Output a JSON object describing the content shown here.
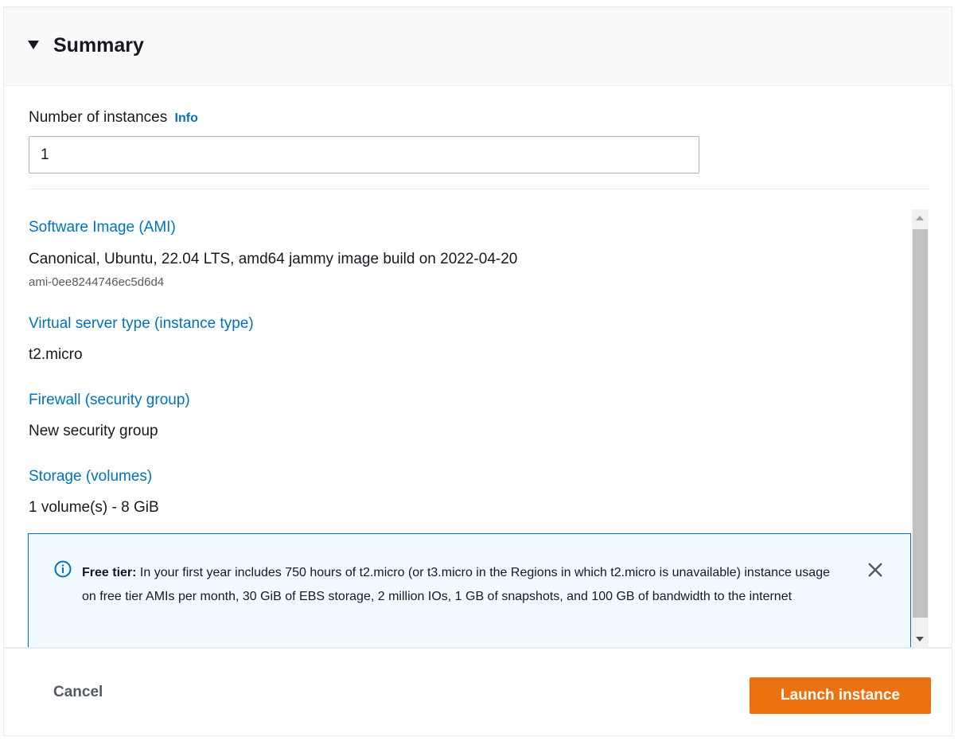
{
  "header": {
    "title": "Summary"
  },
  "instances": {
    "label": "Number of instances",
    "info_link": "Info",
    "value": "1"
  },
  "sections": {
    "ami": {
      "label": "Software Image (AMI)",
      "value": "Canonical, Ubuntu, 22.04 LTS, amd64 jammy image build on 2022-04-20",
      "id": "ami-0ee8244746ec5d6d4"
    },
    "instance_type": {
      "label": "Virtual server type (instance type)",
      "value": "t2.micro"
    },
    "firewall": {
      "label": "Firewall (security group)",
      "value": "New security group"
    },
    "storage": {
      "label": "Storage (volumes)",
      "value": "1 volume(s) - 8 GiB"
    }
  },
  "alert": {
    "title": "Free tier:",
    "text": "In your first year includes 750 hours of t2.micro (or t3.micro in the Regions in which t2.micro is unavailable) instance usage on free tier AMIs per month, 30 GiB of EBS storage, 2 million IOs, 1 GB of snapshots, and 100 GB of bandwidth to the internet",
    "icon": "info-circle-icon",
    "close_icon": "close-icon"
  },
  "footer": {
    "cancel_label": "Cancel",
    "launch_label": "Launch instance"
  },
  "colors": {
    "link": "#0073bb",
    "primary_button": "#ec7211",
    "alert_background": "#f1faff",
    "alert_border": "#0073bb"
  }
}
